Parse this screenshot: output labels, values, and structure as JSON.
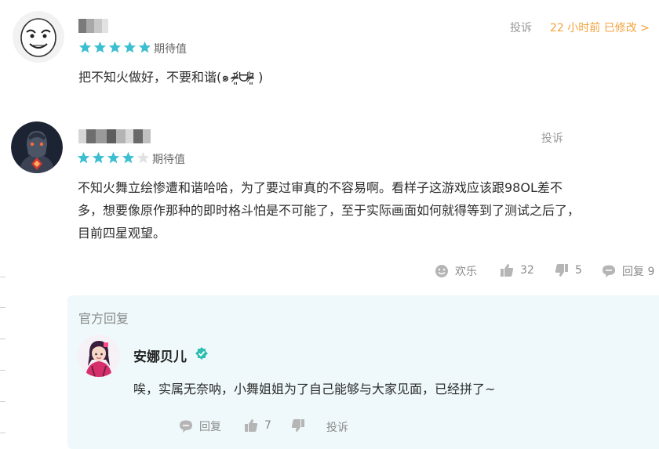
{
  "comments": [
    {
      "tag": "期待值",
      "rating": 5,
      "report": "投诉",
      "time_edit": "22 小时前 已修改 >",
      "text": "把不知火做好，不要和谐(๑ ᵒ̴̶̷͈᷄ᗨᵒ̴̶̷͈᷅ )"
    },
    {
      "tag": "期待值",
      "rating": 4,
      "report": "投诉",
      "text_lines": [
        "不知火舞立绘惨遭和谐哈哈，为了要过审真的不容易啊。看样子这游戏应该跟98OL差不",
        "多，想要像原作那种的即时格斗怕是不可能了，至于实际画面如何就得等到了测试之后了，",
        "目前四星观望。"
      ],
      "actions": {
        "fun": "欢乐",
        "likes": "32",
        "dislikes": "5",
        "reply": "回复 9"
      }
    }
  ],
  "official_reply": {
    "header": "官方回复",
    "name": "安娜贝儿",
    "text": "唉，实属无奈呐，小舞姐姐为了自己能够与大家见面，已经拼了~",
    "actions": {
      "reply": "回复",
      "likes": "7",
      "report": "投诉"
    }
  },
  "colors": {
    "star_active": "#3cbfd0",
    "star_inactive": "#e2e2e2",
    "accent_orange": "#f4a23a",
    "reply_bg": "#eff9fb",
    "verified": "#2fbfb0"
  }
}
